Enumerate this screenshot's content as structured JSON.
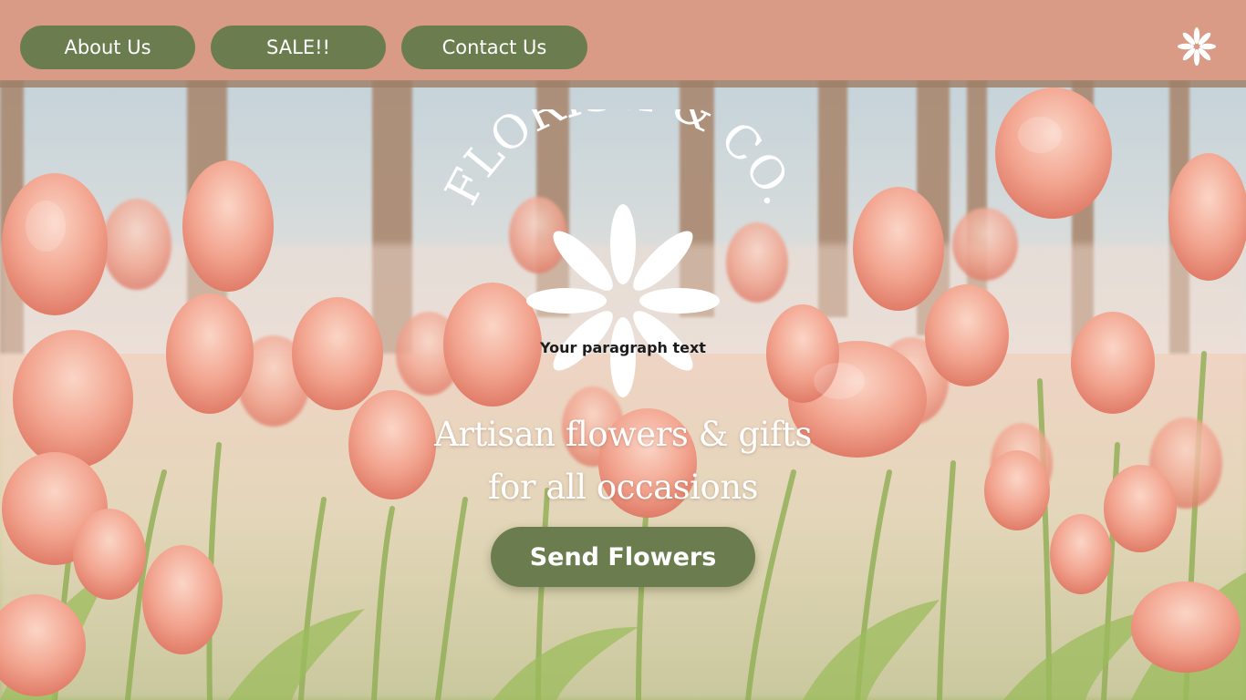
{
  "nav": {
    "items": [
      {
        "label": "About Us"
      },
      {
        "label": "SALE!!"
      },
      {
        "label": "Contact Us"
      }
    ],
    "menu_icon": "flower-icon"
  },
  "logo": {
    "brand_name": "FLORISH & CO.",
    "icon": "daisy-flower-icon"
  },
  "hero": {
    "paragraph_placeholder": "Your paragraph text",
    "headline_line1": "Artisan flowers & gifts",
    "headline_line2": "for all occasions",
    "cta_label": "Send Flowers",
    "background": "pink-tulips-photo"
  },
  "colors": {
    "topbar": "#d99a86",
    "button": "#6b7d4f",
    "text_light": "#ffffff"
  }
}
